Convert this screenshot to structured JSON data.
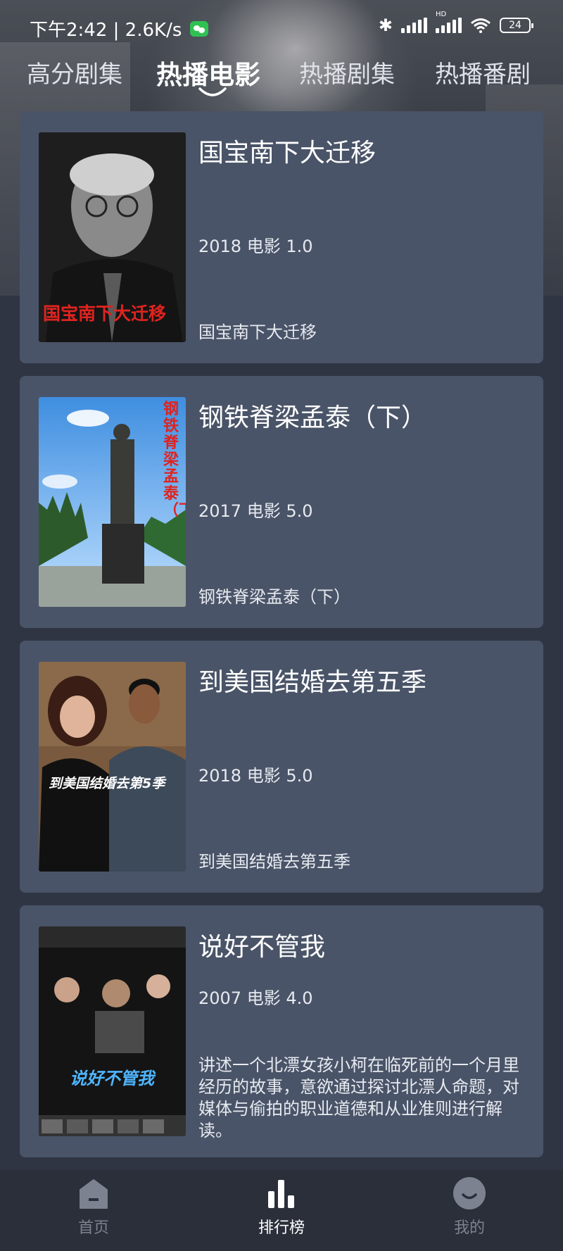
{
  "status_bar": {
    "time_speed": "下午2:42 | 2.6K/s",
    "network_badge": "HD",
    "battery": "24"
  },
  "tabs": [
    {
      "label": "高分剧集",
      "active": false
    },
    {
      "label": "热播电影",
      "active": true
    },
    {
      "label": "热播剧集",
      "active": false
    },
    {
      "label": "热播番剧",
      "active": false
    }
  ],
  "movies": [
    {
      "title": "国宝南下大迁移",
      "meta": "2018 电影 1.0",
      "description": "国宝南下大迁移",
      "poster_text": "国宝南下大迁移"
    },
    {
      "title": "钢铁脊梁孟泰（下）",
      "meta": "2017 电影 5.0",
      "description": "钢铁脊梁孟泰（下）",
      "poster_text": "钢铁脊梁孟泰（下）"
    },
    {
      "title": "到美国结婚去第五季",
      "meta": "2018 电影 5.0",
      "description": "到美国结婚去第五季",
      "poster_text": "到美国结婚去第5季"
    },
    {
      "title": "说好不管我",
      "meta": "2007 电影 4.0",
      "description": "讲述一个北漂女孩小柯在临死前的一个月里经历的故事，意欲通过探讨北漂人命题，对媒体与偷拍的职业道德和从业准则进行解读。",
      "poster_text": "说好不管我"
    }
  ],
  "bottom_nav": [
    {
      "label": "首页",
      "icon": "home-icon",
      "active": false
    },
    {
      "label": "排行榜",
      "icon": "ranking-icon",
      "active": true
    },
    {
      "label": "我的",
      "icon": "profile-icon",
      "active": false
    }
  ],
  "colors": {
    "background": "#2f3543",
    "card": "#4a5468",
    "nav_bar": "#2a2f3a",
    "nav_inactive": "#7d8290",
    "poster_red_text": "#e0231f"
  }
}
